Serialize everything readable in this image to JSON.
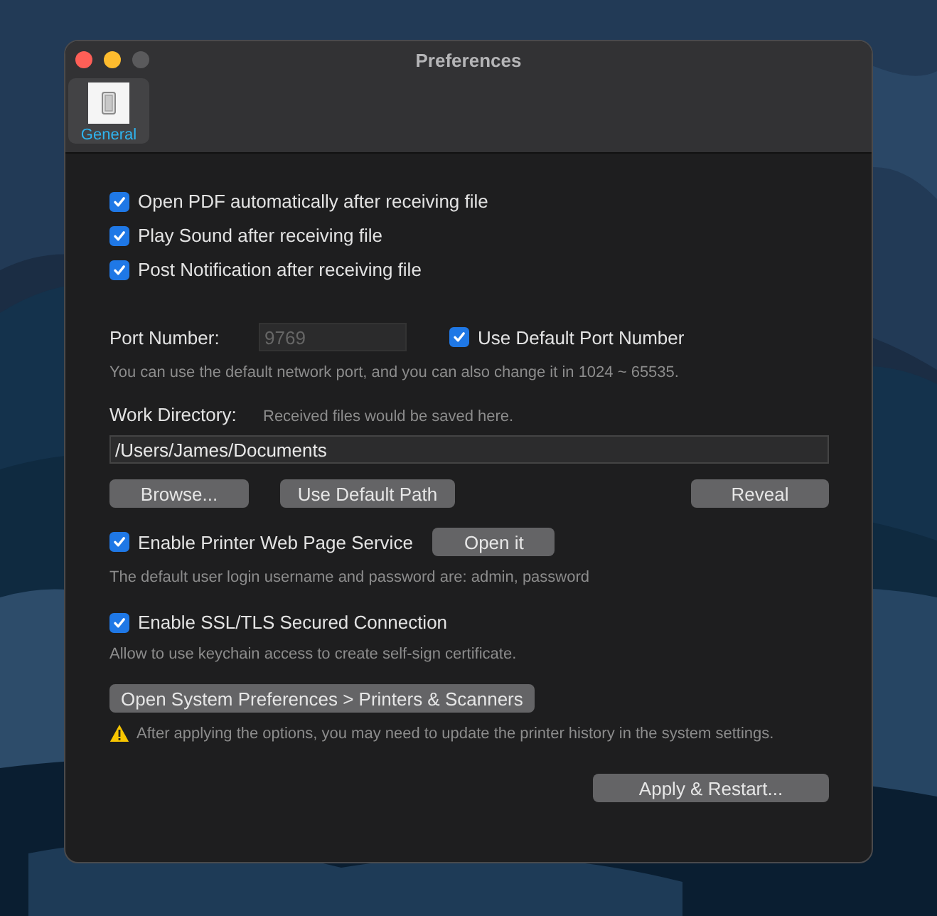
{
  "window": {
    "title": "Preferences"
  },
  "toolbar": [
    {
      "label": "General",
      "selected": true
    }
  ],
  "options": [
    {
      "label": "Open PDF automatically after receiving file",
      "checked": true
    },
    {
      "label": "Play Sound after receiving file",
      "checked": true
    },
    {
      "label": "Post Notification after receiving file",
      "checked": true
    }
  ],
  "port": {
    "label": "Port Number:",
    "value": "9769",
    "disabled": true,
    "default_option": {
      "label": "Use Default Port Number",
      "checked": true
    },
    "hint": "You can use the default network port, and you can also change it in 1024 ~ 65535."
  },
  "work_directory": {
    "label": "Work Directory:",
    "hint": "Received files would be saved here.",
    "path": "/Users/James/Documents",
    "buttons": [
      "Browse...",
      "Use Default Path",
      "Reveal"
    ]
  },
  "printer_service": {
    "label": "Enable Printer Web Page Service",
    "checked": true,
    "button": "Open it",
    "hint": "The default user login username and password are: admin, password"
  },
  "ssl": {
    "label": "Enable SSL/TLS Secured Connection",
    "checked": true,
    "hint": "Allow to use keychain access to create self-sign certificate."
  },
  "system_preferences_button": "Open System Preferences > Printers & Scanners",
  "warning": "After applying the options, you may need to update the printer history in the system settings.",
  "apply_button": "Apply & Restart..."
}
